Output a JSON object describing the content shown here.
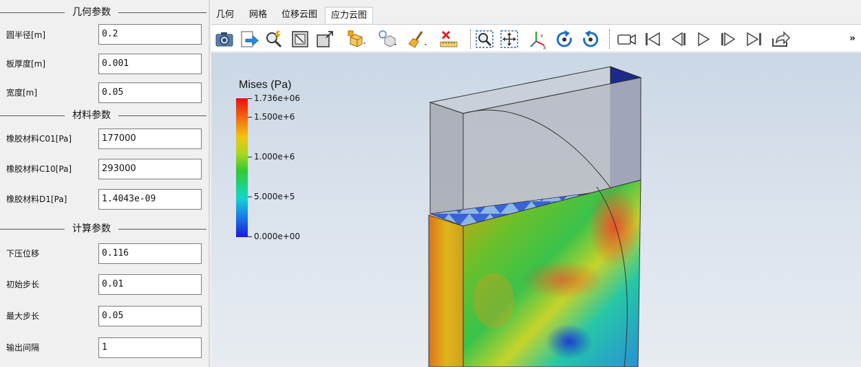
{
  "left_panel": {
    "sections": [
      {
        "title": "几何参数",
        "rows": [
          {
            "label": "圆半径[m]",
            "value": "0.2"
          },
          {
            "label": "板厚度[m]",
            "value": "0.001"
          },
          {
            "label": "宽度[m]",
            "value": "0.05"
          }
        ]
      },
      {
        "title": "材料参数",
        "rows": [
          {
            "label": "橡胶材料C01[Pa]",
            "value": "177000"
          },
          {
            "label": "橡胶材料C10[Pa]",
            "value": "293000"
          },
          {
            "label": "橡胶材料D1[Pa]",
            "value": "1.4043e-09"
          }
        ]
      },
      {
        "title": "计算参数",
        "rows": [
          {
            "label": "下压位移",
            "value": "0.116"
          },
          {
            "label": "初始步长",
            "value": "0.01"
          },
          {
            "label": "最大步长",
            "value": "0.05"
          },
          {
            "label": "输出间隔",
            "value": "1"
          }
        ]
      }
    ]
  },
  "tabs": [
    {
      "label": "几何",
      "active": false
    },
    {
      "label": "网格",
      "active": false
    },
    {
      "label": "位移云图",
      "active": false
    },
    {
      "label": "应力云图",
      "active": true
    }
  ],
  "toolbar": {
    "buttons": [
      "camera-icon",
      "export-icon",
      "pick-icon",
      "fit-box-icon",
      "view-corner-icon",
      "display-mode-icon",
      "light-bulb-icon",
      "clean-brush-icon",
      "measure-ruler-icon",
      "zoom-window-icon",
      "pan-icon",
      "axes-icon",
      "rotate-cw-icon",
      "rotate-ccw-icon",
      "record-video-icon",
      "first-frame-icon",
      "prev-frame-icon",
      "play-icon",
      "next-frame-icon",
      "last-frame-icon",
      "share-export-icon"
    ],
    "overflow": "»"
  },
  "legend": {
    "title": "Mises (Pa)",
    "labels": [
      "1.736e+06",
      "1.500e+6",
      "1.000e+6",
      "5.000e+5",
      "0.000e+00"
    ],
    "colors": {
      "max": "#e8100c",
      "mid": "#35c831",
      "min": "#1a1ae0"
    }
  }
}
